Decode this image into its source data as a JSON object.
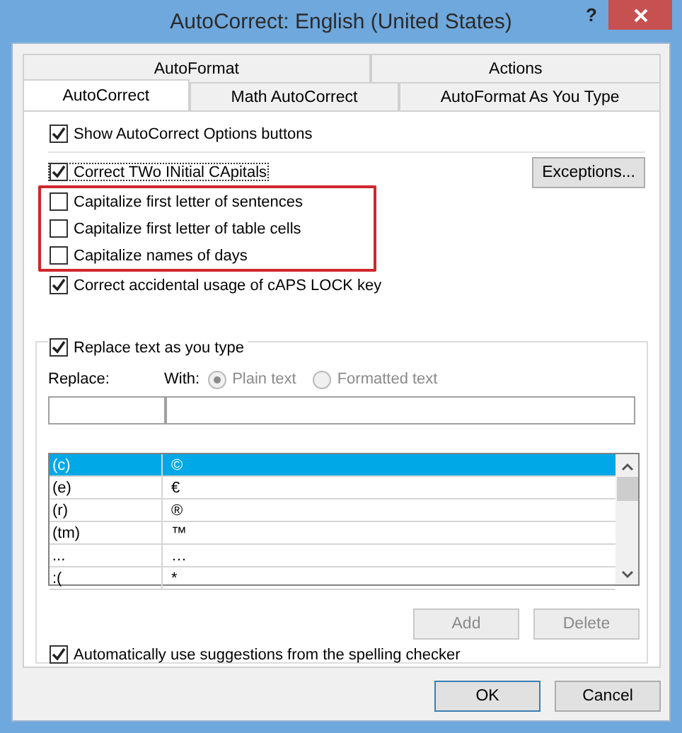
{
  "window": {
    "title": "AutoCorrect: English (United States)",
    "help": "?"
  },
  "tab_rows": [
    {
      "tabs": [
        {
          "label": "AutoFormat",
          "selected": false
        },
        {
          "label": "Actions",
          "selected": false
        }
      ]
    },
    {
      "tabs": [
        {
          "label": "AutoCorrect",
          "selected": true
        },
        {
          "label": "Math AutoCorrect",
          "selected": false
        },
        {
          "label": "AutoFormat As You Type",
          "selected": false
        }
      ]
    }
  ],
  "options": [
    {
      "label": "Show AutoCorrect Options buttons",
      "checked": true,
      "focused": false,
      "highlighted": false
    },
    {
      "label": "Correct TWo INitial CApitals",
      "checked": true,
      "focused": true,
      "highlighted": false,
      "button": "Exceptions..."
    },
    {
      "label": "Capitalize first letter of sentences",
      "checked": false,
      "focused": false,
      "highlighted": true
    },
    {
      "label": "Capitalize first letter of table cells",
      "checked": false,
      "focused": false,
      "highlighted": true
    },
    {
      "label": "Capitalize names of days",
      "checked": false,
      "focused": false,
      "highlighted": true
    },
    {
      "label": "Correct accidental usage of cAPS LOCK key",
      "checked": true,
      "focused": false,
      "highlighted": false
    }
  ],
  "replace_group": {
    "label": "Replace text as you type",
    "checked": true,
    "replace_label": "Replace:",
    "with_label": "With:",
    "formats": [
      {
        "label": "Plain text",
        "selected": true,
        "disabled": true
      },
      {
        "label": "Formatted text",
        "selected": false,
        "disabled": true
      }
    ],
    "entries": [
      {
        "replace": "(c)",
        "with": "©",
        "selected": true
      },
      {
        "replace": "(e)",
        "with": "€",
        "selected": false
      },
      {
        "replace": "(r)",
        "with": "®",
        "selected": false
      },
      {
        "replace": "(tm)",
        "with": "™",
        "selected": false
      },
      {
        "replace": "...",
        "with": "…",
        "selected": false
      },
      {
        "replace": ":(",
        "with": "*",
        "selected": false
      }
    ],
    "buttons": [
      {
        "label": "Add",
        "disabled": true
      },
      {
        "label": "Delete",
        "disabled": true
      }
    ],
    "spelling": {
      "label": "Automatically use suggestions from the spelling checker",
      "checked": true
    }
  },
  "buttons": [
    {
      "label": "OK",
      "default": true
    },
    {
      "label": "Cancel",
      "default": false
    }
  ]
}
